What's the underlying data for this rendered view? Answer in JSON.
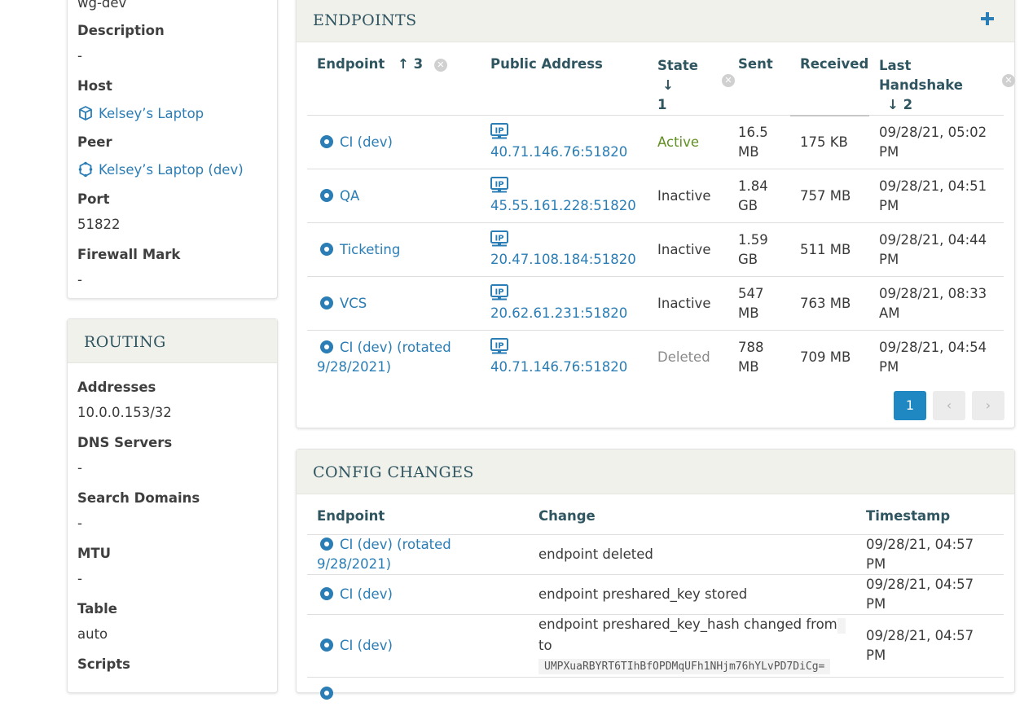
{
  "left_top": {
    "name_value": "wg-dev",
    "description_label": "Description",
    "description_value": "-",
    "host_label": "Host",
    "host_value": "Kelsey’s Laptop",
    "peer_label": "Peer",
    "peer_value": "Kelsey’s Laptop (dev)",
    "port_label": "Port",
    "port_value": "51822",
    "firewall_label": "Firewall Mark",
    "firewall_value": "-"
  },
  "routing": {
    "title": "ROUTING",
    "addresses_label": "Addresses",
    "addresses_value": "10.0.0.153/32",
    "dns_label": "DNS Servers",
    "dns_value": "-",
    "search_label": "Search Domains",
    "search_value": "-",
    "mtu_label": "MTU",
    "mtu_value": "-",
    "table_label": "Table",
    "table_value": "auto",
    "scripts_label": "Scripts"
  },
  "endpoints": {
    "title": "ENDPOINTS",
    "add_icon": "plus-icon",
    "headers": {
      "endpoint": "Endpoint",
      "endpoint_sort": "↑ 3",
      "public_address": "Public Address",
      "state": "State",
      "state_sort": "↓",
      "state_order": "1",
      "sent": "Sent",
      "received": "Received",
      "last_handshake": "Last Handshake",
      "handshake_sort": "↓ 2"
    },
    "rows": [
      {
        "name": "CI (dev)",
        "address": "40.71.146.76:51820",
        "state": "Active",
        "sent": "16.5 MB",
        "received": "175 KB",
        "handshake": "09/28/21, 05:02 PM"
      },
      {
        "name": "QA",
        "address": "45.55.161.228:51820",
        "state": "Inactive",
        "sent": "1.84 GB",
        "received": "757 MB",
        "handshake": "09/28/21, 04:51 PM"
      },
      {
        "name": "Ticketing",
        "address": "20.47.108.184:51820",
        "state": "Inactive",
        "sent": "1.59 GB",
        "received": "511 MB",
        "handshake": "09/28/21, 04:44 PM"
      },
      {
        "name": "VCS",
        "address": "20.62.61.231:51820",
        "state": "Inactive",
        "sent": "547 MB",
        "received": "763 MB",
        "handshake": "09/28/21, 08:33 AM"
      },
      {
        "name": "CI (dev) (rotated 9/28/2021)",
        "address": "40.71.146.76:51820",
        "state": "Deleted",
        "sent": "788 MB",
        "received": "709 MB",
        "handshake": "09/28/21, 04:54 PM"
      }
    ],
    "page": "1",
    "prev_icon": "chevron-left-icon",
    "next_icon": "chevron-right-icon"
  },
  "config": {
    "title": "CONFIG CHANGES",
    "headers": {
      "endpoint": "Endpoint",
      "change": "Change",
      "timestamp": "Timestamp"
    },
    "rows": [
      {
        "name": "CI (dev) (rotated 9/28/2021)",
        "change": "endpoint deleted",
        "timestamp": "09/28/21, 04:57 PM"
      },
      {
        "name": "CI (dev)",
        "change": "endpoint preshared_key stored",
        "timestamp": "09/28/21, 04:57 PM"
      },
      {
        "name": "CI (dev)",
        "change": "endpoint preshared_key_hash changed from",
        "change_to": "to",
        "change_code": "UMPXuaRBYRT6TIhBfOPDMqUFh1NHjm76hYLvPD7DiCg=",
        "timestamp": "09/28/21, 04:57 PM"
      }
    ]
  },
  "colors": {
    "link": "#2a7db5",
    "active": "#5f8f1f",
    "panel_head": "#f1f1ec",
    "page_button": "#1f88c2"
  }
}
